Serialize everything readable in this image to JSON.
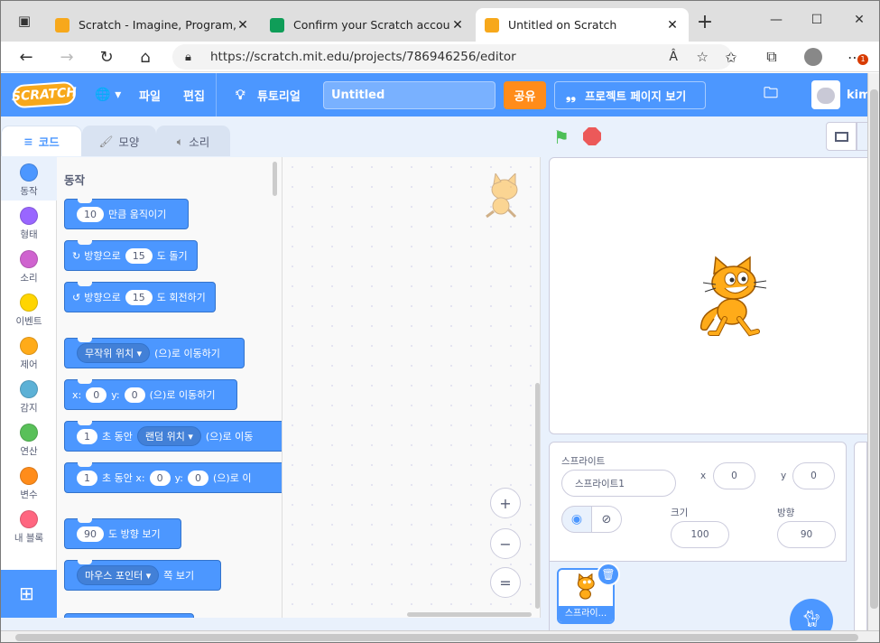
{
  "browser": {
    "tabs": [
      {
        "title": "Scratch - Imagine, Program, Sha",
        "close": "✕"
      },
      {
        "title": "Confirm your Scratch account",
        "close": "✕"
      },
      {
        "title": "Untitled on Scratch",
        "close": "✕"
      }
    ],
    "new_tab": "+",
    "window_controls": {
      "minimize": "—",
      "maximize": "☐",
      "close": "✕"
    },
    "url": "https://scratch.mit.edu/projects/786946256/editor",
    "read_aloud": "Â",
    "notification_count": "1"
  },
  "menu": {
    "logo": "SCRATCH",
    "language": "🌐 ▾",
    "file": "파일",
    "edit": "편집",
    "tutorials": "튜토리얼",
    "project_title": "Untitled",
    "share": "공유",
    "see_project": "프로젝트 페이지 보기",
    "username": "kim"
  },
  "editor_tabs": {
    "code": "코드",
    "costumes": "모양",
    "sounds": "소리"
  },
  "categories": [
    {
      "label": "동작",
      "color": "#4c97ff"
    },
    {
      "label": "형태",
      "color": "#9966ff"
    },
    {
      "label": "소리",
      "color": "#cf63cf"
    },
    {
      "label": "이벤트",
      "color": "#ffd500"
    },
    {
      "label": "제어",
      "color": "#ffab19"
    },
    {
      "label": "감지",
      "color": "#5cb1d6"
    },
    {
      "label": "연산",
      "color": "#59c059"
    },
    {
      "label": "변수",
      "color": "#ff8c1a"
    },
    {
      "label": "내 블록",
      "color": "#ff6680"
    }
  ],
  "palette": {
    "heading": "동작",
    "b1": {
      "v": "10",
      "t": "만큼 움직이기"
    },
    "b2": {
      "a": "방향으로",
      "v": "15",
      "t": "도 돌기"
    },
    "b3": {
      "a": "방향으로",
      "v": "15",
      "t": "도 회전하기"
    },
    "b4": {
      "dd": "무작위 위치 ▾",
      "t": "(으)로 이동하기"
    },
    "b5": {
      "x": "x:",
      "xv": "0",
      "y": "y:",
      "yv": "0",
      "t": "(으)로 이동하기"
    },
    "b6": {
      "v": "1",
      "a": "초 동안",
      "dd": "랜덤 위치 ▾",
      "t": "(으)로 이동"
    },
    "b7": {
      "v": "1",
      "a": "초 동안 x:",
      "xv": "0",
      "y": "y:",
      "yv": "0",
      "t": "(으)로 이"
    },
    "b8": {
      "v": "90",
      "t": "도 방향 보기"
    },
    "b9": {
      "dd": "마우스 포인터 ▾",
      "t": "쪽 보기"
    }
  },
  "zoom": {
    "in": "+",
    "out": "−",
    "reset": "="
  },
  "sprite_info": {
    "sprite_label": "스프라이트",
    "sprite_name": "스프라이트1",
    "x_label": "x",
    "x": "0",
    "y_label": "y",
    "y": "0",
    "size_label": "크기",
    "size": "100",
    "direction_label": "방향",
    "direction": "90"
  },
  "sprite_list": {
    "thumb_name": "스프라이..."
  }
}
